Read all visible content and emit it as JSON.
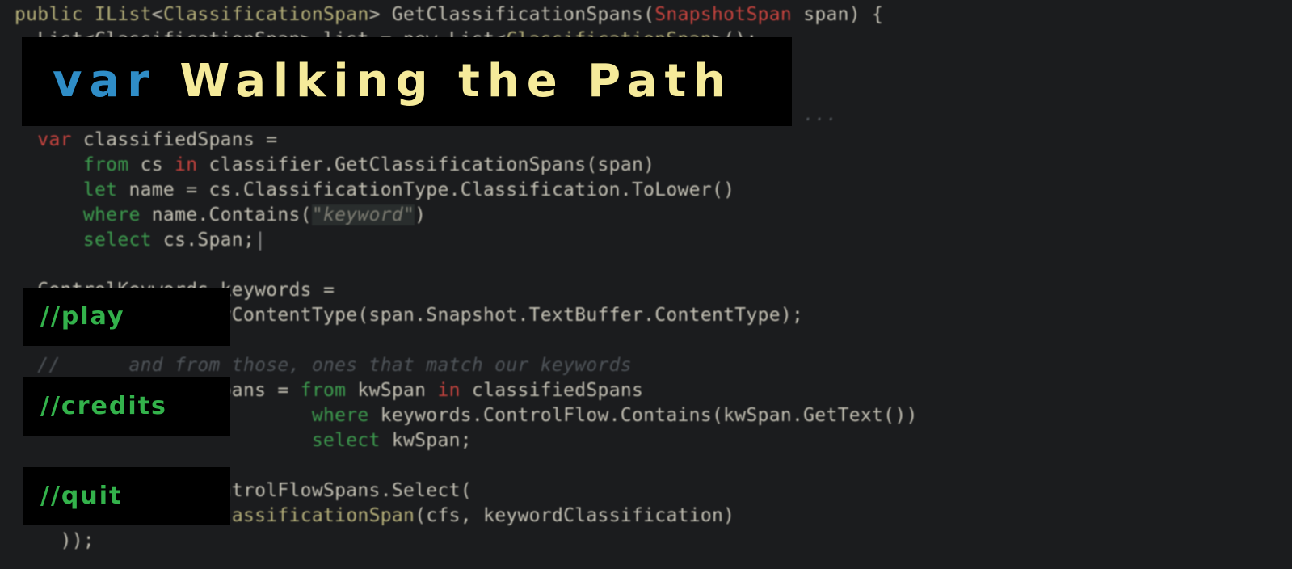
{
  "title": {
    "var_label": "var",
    "name_label": "Walking the Path"
  },
  "menu": {
    "play_label": "//play",
    "credits_label": "//credits",
    "quit_label": "//quit"
  },
  "code_background": {
    "lines": [
      [
        [
          "type",
          "public IList"
        ],
        [
          "plain",
          "<"
        ],
        [
          "type",
          "ClassificationSpan"
        ],
        [
          "plain",
          "> GetClassificationSpans("
        ],
        [
          "kw",
          "SnapshotSpan"
        ],
        [
          "plain",
          " span) {"
        ]
      ],
      [
        [
          "plain",
          "  List<ClassificationSpan> list = new List<"
        ],
        [
          "type",
          "ClassificationSpan"
        ],
        [
          "plain",
          ">();"
        ]
      ],
      [],
      [],
      [
        [
          "comment",
          "  // ...                              already classified as keywords ..."
        ]
      ],
      [
        [
          "kw",
          "  var"
        ],
        [
          "plain",
          " classifiedSpans ="
        ]
      ],
      [
        [
          "green",
          "      from"
        ],
        [
          "plain",
          " cs "
        ],
        [
          "kw",
          "in"
        ],
        [
          "plain",
          " classifier.GetClassificationSpans(span)"
        ]
      ],
      [
        [
          "green",
          "      let"
        ],
        [
          "plain",
          " name = cs.ClassificationType.Classification.ToLower()"
        ]
      ],
      [
        [
          "green",
          "      where"
        ],
        [
          "plain",
          " name.Contains("
        ],
        [
          "string",
          "\"keyword\""
        ],
        [
          "plain",
          ")"
        ]
      ],
      [
        [
          "green",
          "      select"
        ],
        [
          "plain",
          " cs.Span;"
        ],
        [
          "cursor",
          "|"
        ]
      ],
      [],
      [
        [
          "plain",
          "  ControlKeywords keywords ="
        ]
      ],
      [
        [
          "plain",
          "      GetKeywordsByContentType(span.Snapshot.TextBuffer.ContentType);"
        ]
      ],
      [],
      [
        [
          "comment",
          "  //      and from those, ones that match our keywords"
        ]
      ],
      [
        [
          "kw",
          "  var"
        ],
        [
          "plain",
          " controlFlowSpans = "
        ],
        [
          "green",
          "from"
        ],
        [
          "plain",
          " kwSpan "
        ],
        [
          "kw",
          "in"
        ],
        [
          "plain",
          " classifiedSpans"
        ]
      ],
      [
        [
          "green",
          "                          where"
        ],
        [
          "plain",
          " keywords.ControlFlow.Contains(kwSpan.GetText())"
        ]
      ],
      [
        [
          "green",
          "                          select"
        ],
        [
          "plain",
          " kwSpan;"
        ]
      ],
      [],
      [
        [
          "plain",
          "  list.AddRange(controlFlowSpans.Select("
        ]
      ],
      [
        [
          "plain",
          "      cfs "
        ],
        [
          "kw",
          "=>"
        ],
        [
          "plain",
          " "
        ],
        [
          "kw",
          "new"
        ],
        [
          "plain",
          " "
        ],
        [
          "type",
          "ClassificationSpan"
        ],
        [
          "plain",
          "(cfs, keywordClassification)"
        ]
      ],
      [
        [
          "plain",
          "    ));"
        ]
      ]
    ]
  }
}
